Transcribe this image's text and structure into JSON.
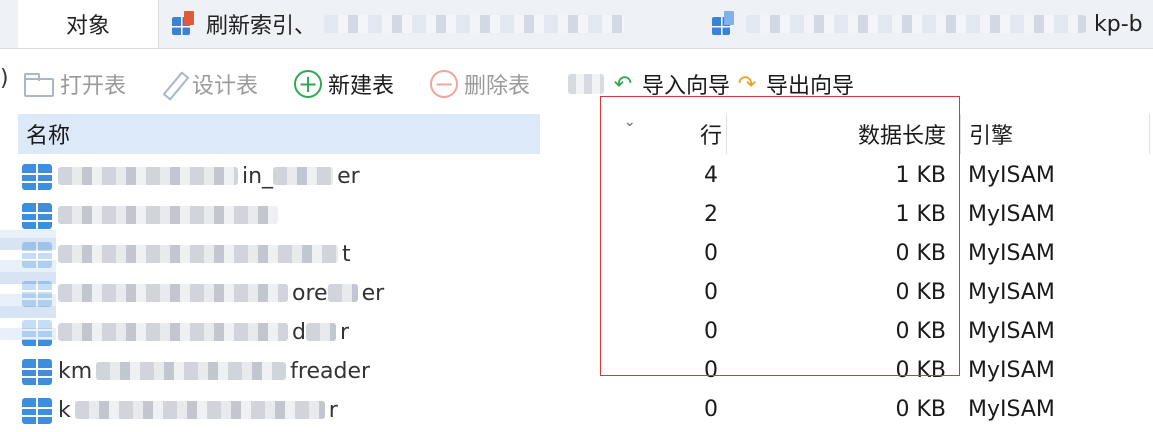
{
  "tabs": [
    {
      "label": "对象",
      "icon": "none",
      "active": true
    },
    {
      "label": "刷新索引、",
      "icon": "table-edit-icon",
      "active": false
    },
    {
      "label": "kp-b",
      "icon": "table-doc-icon",
      "active": false
    }
  ],
  "toolbar": {
    "open_label": "打开表",
    "design_label": "设计表",
    "new_label": "新建表",
    "delete_label": "删除表",
    "import_label": "导入向导",
    "export_label": "导出向导"
  },
  "columns": {
    "name": "名称",
    "rows": "行",
    "data_length": "数据长度",
    "engine": "引擎"
  },
  "table_rows": [
    {
      "name_visible": "in_",
      "name_suffix": "er",
      "rows": "4",
      "data_length": "1 KB",
      "engine": "MyISAM"
    },
    {
      "name_visible": "",
      "name_suffix": "",
      "rows": "2",
      "data_length": "1 KB",
      "engine": "MyISAM"
    },
    {
      "name_visible": "",
      "name_suffix": "t",
      "rows": "0",
      "data_length": "0 KB",
      "engine": "MyISAM"
    },
    {
      "name_visible": "ore",
      "name_suffix": "er",
      "rows": "0",
      "data_length": "0 KB",
      "engine": "MyISAM"
    },
    {
      "name_visible": "d",
      "name_suffix": "r",
      "rows": "0",
      "data_length": "0 KB",
      "engine": "MyISAM"
    },
    {
      "name_visible": "km",
      "name_suffix": "freader",
      "rows": "0",
      "data_length": "0 KB",
      "engine": "MyISAM"
    },
    {
      "name_visible": "k",
      "name_suffix": "r",
      "rows": "0",
      "data_length": "0 KB",
      "engine": "MyISAM"
    }
  ],
  "colors": {
    "selection_header": "#dce9f8",
    "annotation_red": "#d9383a",
    "new_green": "#2fa84f",
    "table_icon_blue": "#3e8ee0"
  }
}
